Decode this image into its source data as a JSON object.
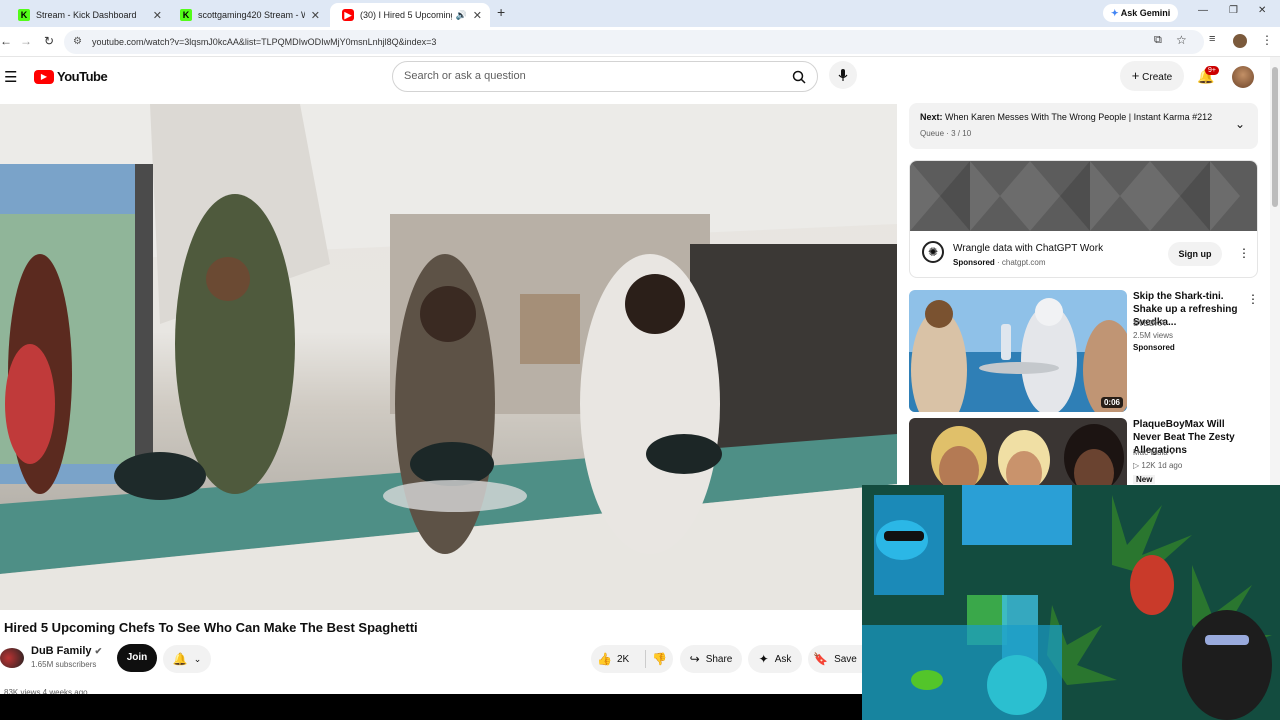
{
  "browser": {
    "tabs": [
      {
        "title": "Stream - Kick Dashboard",
        "favicon": "kick-icon"
      },
      {
        "title": "scottgaming420 Stream - Watc",
        "favicon": "kick-icon"
      },
      {
        "title": "(30) I Hired 5 Upcoming Ch",
        "favicon": "youtube-icon"
      }
    ],
    "gemini_label": "Ask Gemini",
    "url": "youtube.com/watch?v=3lqsmJ0kcAA&list=TLPQMDIwODIwMjY0msnLnhjl8Q&index=3"
  },
  "youtube": {
    "logo_text": "YouTube",
    "search_placeholder": "Search or ask a question",
    "create_label": "Create",
    "notification_badge": "9+"
  },
  "video": {
    "title": "Hired 5 Upcoming Chefs To See Who Can Make The Best Spaghetti",
    "channel": "DuB Family",
    "subscribers": "1.65M subscribers",
    "join_label": "Join",
    "likes": "2K",
    "share_label": "Share",
    "ask_label": "Ask",
    "save_label": "Save",
    "views_partial": "83K views  4 weeks ago"
  },
  "queue": {
    "next_prefix": "Next:",
    "next_title": "When Karen Messes With The Wrong People | Instant Karma #212",
    "position": "Queue · 3 / 10"
  },
  "ad": {
    "title": "Wrangle data with ChatGPT Work",
    "sponsored": "Sponsored",
    "domain": "· chatgpt.com",
    "cta": "Sign up"
  },
  "recommendations": [
    {
      "title": "Skip the Shark-tini. Shake up a refreshing Svedka...",
      "channel": "SVEDKA",
      "views": "2.5M views",
      "badge": "Sponsored",
      "duration": "0:06"
    },
    {
      "title": "PlaqueBoyMax Will Never Beat The Zesty Allegations",
      "channel": "Mac Mula",
      "views": "12K",
      "age": "1d ago",
      "badge": "New"
    }
  ],
  "colors": {
    "youtube_red": "#ff0000",
    "kick_green": "#53fc18",
    "tab_strip": "#dfe8f5"
  }
}
